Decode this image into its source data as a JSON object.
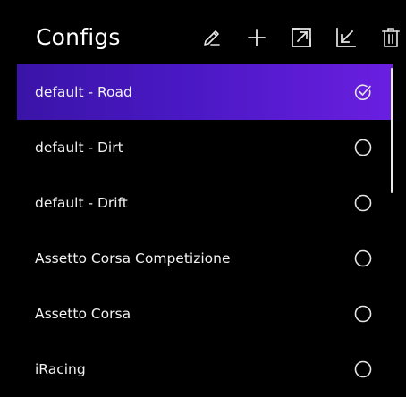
{
  "header": {
    "title": "Configs"
  },
  "toolbar": {
    "items": [
      {
        "name": "edit",
        "icon": "pencil-icon"
      },
      {
        "name": "add",
        "icon": "plus-icon"
      },
      {
        "name": "export",
        "icon": "export-icon"
      },
      {
        "name": "import",
        "icon": "import-icon"
      },
      {
        "name": "delete",
        "icon": "trash-icon"
      }
    ]
  },
  "configs": {
    "items": [
      {
        "label": "default - Road",
        "selected": true
      },
      {
        "label": "default - Dirt",
        "selected": false
      },
      {
        "label": "default - Drift",
        "selected": false
      },
      {
        "label": "Assetto Corsa Competizione",
        "selected": false
      },
      {
        "label": "Assetto Corsa",
        "selected": false
      },
      {
        "label": "iRacing",
        "selected": false
      }
    ]
  },
  "colors": {
    "background": "#000000",
    "selected_start": "#3a14a8",
    "selected_end": "#6a1fe0",
    "text": "#f2f2f2",
    "icon": "#e6e6e6"
  }
}
